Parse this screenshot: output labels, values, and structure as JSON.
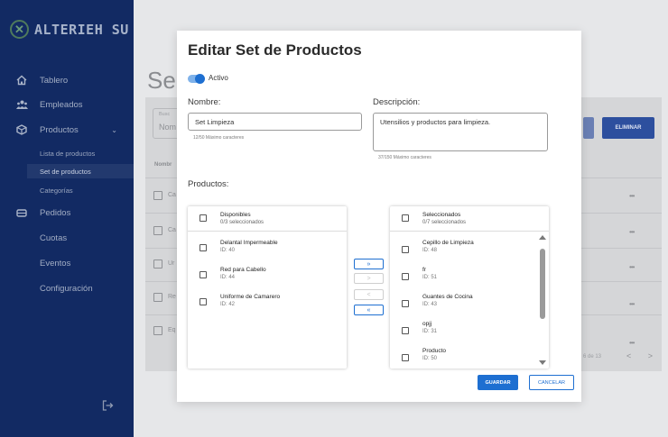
{
  "app": {
    "logo_text": "ALTERIEH SU",
    "logo_icon": "close-x-circle-icon"
  },
  "sidebar": {
    "items": [
      {
        "label": "Tablero",
        "icon": "home-icon"
      },
      {
        "label": "Empleados",
        "icon": "people-icon"
      },
      {
        "label": "Productos",
        "icon": "box-icon",
        "caret": "⌄"
      },
      {
        "label": "Pedidos",
        "icon": "cart-icon"
      },
      {
        "label": "Cuotas"
      },
      {
        "label": "Eventos"
      },
      {
        "label": "Configuración"
      }
    ],
    "subitems": [
      "Lista de productos",
      "Set de productos",
      "Categorías"
    ],
    "active_subitem": "Set de productos",
    "logout_icon": "logout-icon"
  },
  "background": {
    "page_title": "Se",
    "search_label": "Busc",
    "search_value": "Nom",
    "delete_button": "ELIMINAR",
    "column_header": "Nombr",
    "rows": [
      "Ca",
      "Ca",
      "Ur",
      "Re",
      "Eq"
    ],
    "pagination": "6 de 13",
    "pager_prev": "<",
    "pager_next": ">",
    "row_menu": "•••"
  },
  "modal": {
    "title": "Editar Set de Productos",
    "active_label": "Activo",
    "active": true,
    "name_label": "Nombre:",
    "name_value": "Set Limpieza",
    "name_helper": "12/50 Máximo caracteres",
    "desc_label": "Descripción:",
    "desc_value": "Utensilios y productos para limpieza.",
    "desc_helper": "37/150 Máximo caracteres",
    "products_label": "Productos:",
    "available": {
      "title": "Disponibles",
      "count": "0/3 seleccionados",
      "items": [
        {
          "name": "Delantal Impermeable",
          "id": "ID: 40"
        },
        {
          "name": "Red para Cabello",
          "id": "ID: 44"
        },
        {
          "name": "Uniforme de Camarero",
          "id": "ID: 42"
        }
      ]
    },
    "selected": {
      "title": "Seleccionados",
      "count": "0/7 seleccionados",
      "items": [
        {
          "name": "Cepillo de Limpieza",
          "id": "ID: 48"
        },
        {
          "name": "fr",
          "id": "ID: 51"
        },
        {
          "name": "Guantes de Cocina",
          "id": "ID: 43"
        },
        {
          "name": "opjj",
          "id": "ID: 31"
        },
        {
          "name": "Producto",
          "id": "ID: 50"
        }
      ]
    },
    "move_buttons": {
      "all_right": "»",
      "right": ">",
      "left": "<",
      "all_left": "«"
    },
    "save_label": "GUARDAR",
    "cancel_label": "CANCELAR"
  }
}
